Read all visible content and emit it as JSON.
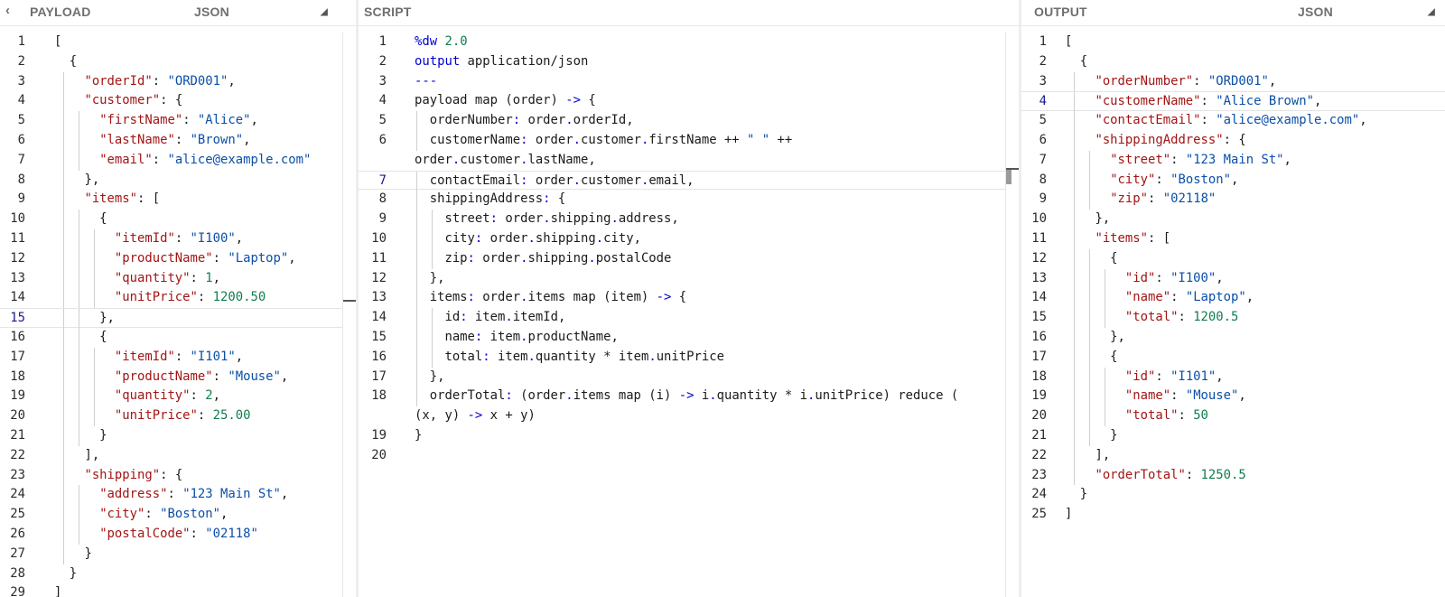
{
  "payload": {
    "title": "PAYLOAD",
    "format": "JSON",
    "back_icon": "chevron-left-icon",
    "lines": [
      "[",
      "  {",
      "    \"orderId\": \"ORD001\",",
      "    \"customer\": {",
      "      \"firstName\": \"Alice\",",
      "      \"lastName\": \"Brown\",",
      "      \"email\": \"alice@example.com\"",
      "    },",
      "    \"items\": [",
      "      {",
      "        \"itemId\": \"I100\",",
      "        \"productName\": \"Laptop\",",
      "        \"quantity\": 1,",
      "        \"unitPrice\": 1200.50",
      "      },",
      "      {",
      "        \"itemId\": \"I101\",",
      "        \"productName\": \"Mouse\",",
      "        \"quantity\": 2,",
      "        \"unitPrice\": 25.00",
      "      }",
      "    ],",
      "    \"shipping\": {",
      "      \"address\": \"123 Main St\",",
      "      \"city\": \"Boston\",",
      "      \"postalCode\": \"02118\"",
      "    }",
      "  }",
      "]"
    ],
    "active_line": 15
  },
  "script": {
    "title": "SCRIPT",
    "lines": [
      {
        "n": "1",
        "text": "%dw 2.0"
      },
      {
        "n": "2",
        "text": "output application/json"
      },
      {
        "n": "3",
        "text": "---"
      },
      {
        "n": "4",
        "text": "payload map (order) -> {"
      },
      {
        "n": "5",
        "text": "  orderNumber: order.orderId,"
      },
      {
        "n": "6",
        "text": "  customerName: order.customer.firstName ++ \" \" ++"
      },
      {
        "n": "",
        "text": "order.customer.lastName,"
      },
      {
        "n": "7",
        "text": "  contactEmail: order.customer.email,"
      },
      {
        "n": "8",
        "text": "  shippingAddress: {"
      },
      {
        "n": "9",
        "text": "    street: order.shipping.address,"
      },
      {
        "n": "10",
        "text": "    city: order.shipping.city,"
      },
      {
        "n": "11",
        "text": "    zip: order.shipping.postalCode"
      },
      {
        "n": "12",
        "text": "  },"
      },
      {
        "n": "13",
        "text": "  items: order.items map (item) -> {"
      },
      {
        "n": "14",
        "text": "    id: item.itemId,"
      },
      {
        "n": "15",
        "text": "    name: item.productName,"
      },
      {
        "n": "16",
        "text": "    total: item.quantity * item.unitPrice"
      },
      {
        "n": "17",
        "text": "  },"
      },
      {
        "n": "18",
        "text": "  orderTotal: (order.items map (i) -> i.quantity * i.unitPrice) reduce ("
      },
      {
        "n": "",
        "text": "(x, y) -> x + y)"
      },
      {
        "n": "19",
        "text": "}"
      },
      {
        "n": "20",
        "text": ""
      }
    ],
    "active_line": "7"
  },
  "output": {
    "title": "OUTPUT",
    "format": "JSON",
    "lines": [
      "[",
      "  {",
      "    \"orderNumber\": \"ORD001\",",
      "    \"customerName\": \"Alice Brown\",",
      "    \"contactEmail\": \"alice@example.com\",",
      "    \"shippingAddress\": {",
      "      \"street\": \"123 Main St\",",
      "      \"city\": \"Boston\",",
      "      \"zip\": \"02118\"",
      "    },",
      "    \"items\": [",
      "      {",
      "        \"id\": \"I100\",",
      "        \"name\": \"Laptop\",",
      "        \"total\": 1200.5",
      "      },",
      "      {",
      "        \"id\": \"I101\",",
      "        \"name\": \"Mouse\",",
      "        \"total\": 50",
      "      }",
      "    ],",
      "    \"orderTotal\": 1250.5",
      "  }",
      "]"
    ],
    "active_line": 4
  }
}
